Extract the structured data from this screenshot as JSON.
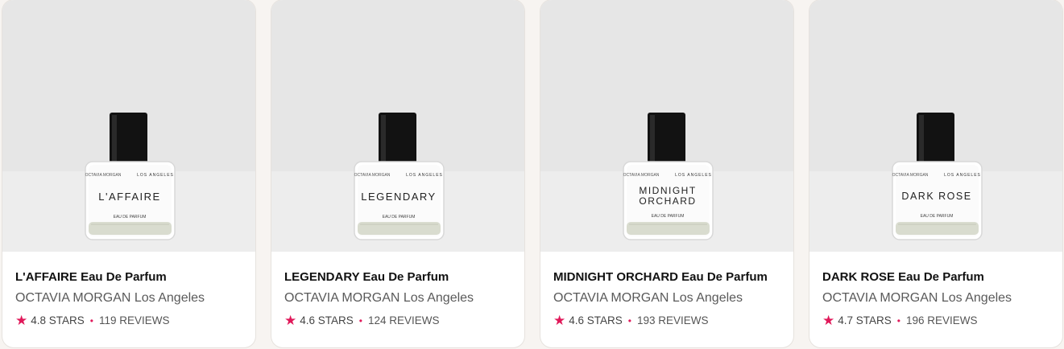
{
  "products": [
    {
      "title": "L'AFFAIRE Eau De Parfum",
      "brand": "OCTAVIA MORGAN Los Angeles",
      "stars": "4.8 STARS",
      "reviews": "119 REVIEWS",
      "label_brand_left": "OCTAVIA MORGAN",
      "label_brand_right": "LOS ANGELES",
      "label_name_line1": "L'AFFAIRE",
      "label_name_line2": "",
      "label_type": "EAU DE PARFUM"
    },
    {
      "title": "LEGENDARY Eau De Parfum",
      "brand": "OCTAVIA MORGAN Los Angeles",
      "stars": "4.6 STARS",
      "reviews": "124 REVIEWS",
      "label_brand_left": "OCTAVIA MORGAN",
      "label_brand_right": "LOS ANGELES",
      "label_name_line1": "LEGENDARY",
      "label_name_line2": "",
      "label_type": "EAU DE PARFUM"
    },
    {
      "title": "MIDNIGHT ORCHARD Eau De Parfum",
      "brand": "OCTAVIA MORGAN Los Angeles",
      "stars": "4.6 STARS",
      "reviews": "193 REVIEWS",
      "label_brand_left": "OCTAVIA MORGAN",
      "label_brand_right": "LOS ANGELES",
      "label_name_line1": "MIDNIGHT",
      "label_name_line2": "ORCHARD",
      "label_type": "EAU DE PARFUM"
    },
    {
      "title": "DARK ROSE Eau De Parfum",
      "brand": "OCTAVIA MORGAN Los Angeles",
      "stars": "4.7 STARS",
      "reviews": "196 REVIEWS",
      "label_brand_left": "OCTAVIA MORGAN",
      "label_brand_right": "LOS ANGELES",
      "label_name_line1": "DARK ROSE",
      "label_name_line2": "",
      "label_type": "EAU DE PARFUM"
    }
  ],
  "colors": {
    "accent": "#e0195a",
    "bg": "#f7f4f1",
    "photo_bg": "#e6e6e6"
  },
  "icons": {
    "rating": "star-icon",
    "separator": "dot-icon"
  }
}
